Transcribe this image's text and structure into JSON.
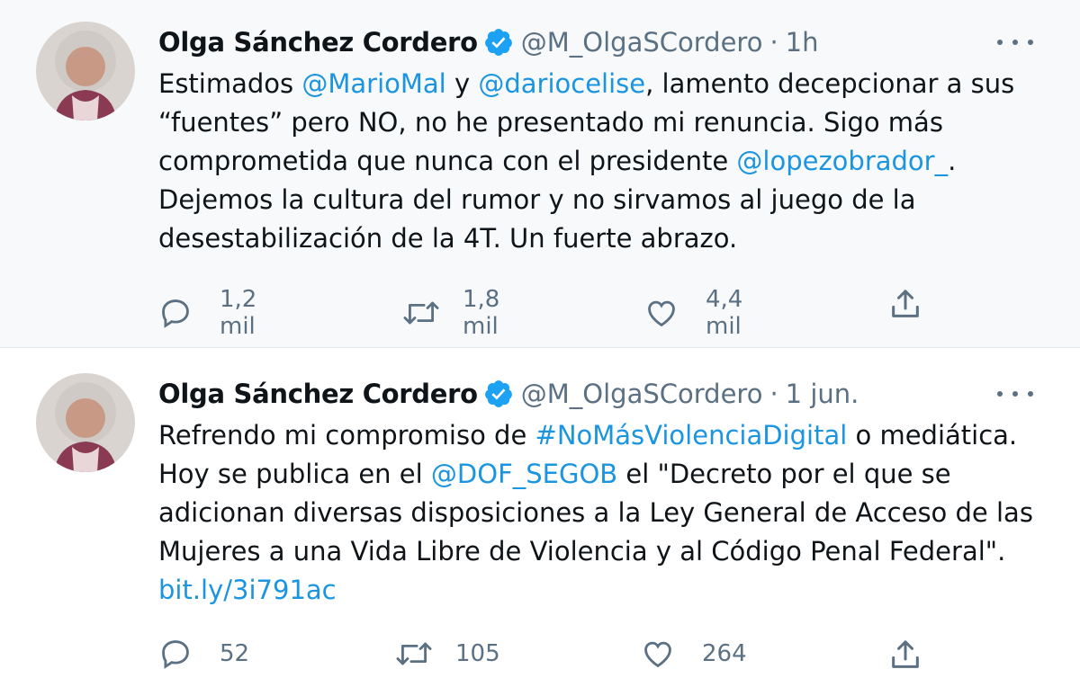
{
  "tweets": [
    {
      "name": "Olga Sánchez Cordero",
      "handle": "@M_OlgaSCordero",
      "separator": "·",
      "time": "1h",
      "text": [
        {
          "t": "Estimados ",
          "link": false
        },
        {
          "t": "@MarioMal",
          "link": true
        },
        {
          "t": " y ",
          "link": false
        },
        {
          "t": "@dariocelise",
          "link": true
        },
        {
          "t": ", lamento decepcionar a sus “fuentes” pero NO, no he presentado mi renuncia. Sigo más comprometida que nunca con el presidente ",
          "link": false
        },
        {
          "t": "@lopezobrador_",
          "link": true
        },
        {
          "t": ". Dejemos la cultura del rumor y no sirvamos al juego de la desestabilización de la 4T. Un fuerte abrazo.",
          "link": false
        }
      ],
      "replies": "1,2 mil",
      "retweets": "1,8 mil",
      "likes": "4,4 mil"
    },
    {
      "name": "Olga Sánchez Cordero",
      "handle": "@M_OlgaSCordero",
      "separator": "·",
      "time": "1 jun.",
      "text": [
        {
          "t": "Refrendo mi compromiso de ",
          "link": false
        },
        {
          "t": "#NoMásViolenciaDigital",
          "link": true
        },
        {
          "t": " o mediática. Hoy se publica en el ",
          "link": false
        },
        {
          "t": "@DOF_SEGOB",
          "link": true
        },
        {
          "t": " el \"Decreto por el que se adicionan diversas disposiciones a la Ley General de Acceso de las Mujeres a una Vida Libre de Violencia y al Código Penal Federal\". ",
          "link": false
        },
        {
          "t": "bit.ly/3i791ac",
          "link": true
        }
      ],
      "replies": "52",
      "retweets": "105",
      "likes": "264"
    }
  ],
  "colors": {
    "link": "#1b95e0",
    "secondary": "#5b7083",
    "verified": "#1da1f2"
  }
}
